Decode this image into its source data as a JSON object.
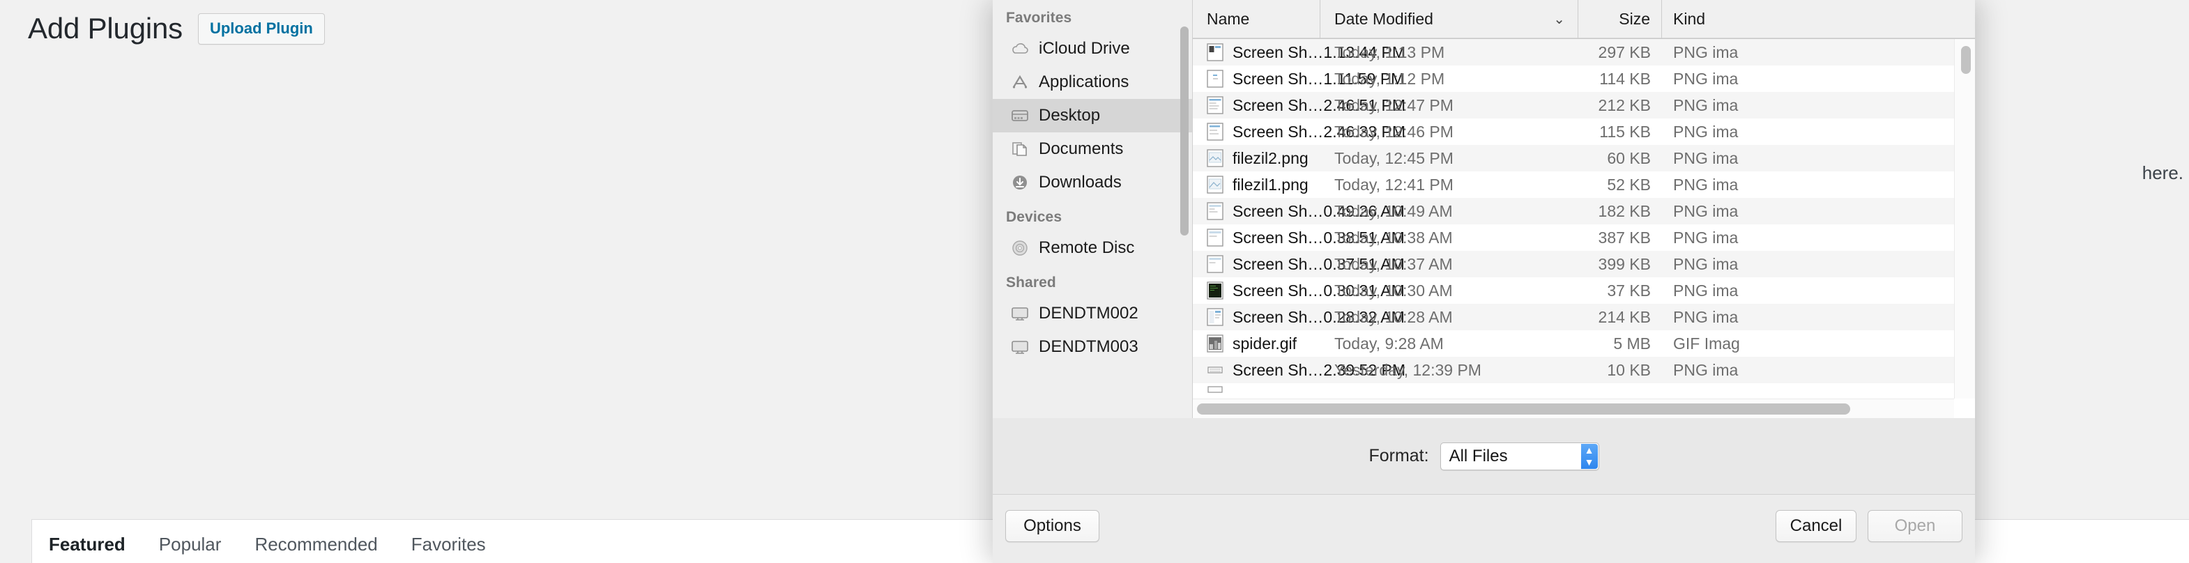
{
  "wp": {
    "title": "Add Plugins",
    "upload_button": "Upload Plugin",
    "upload_hint_visible": "here.",
    "tabs": [
      {
        "label": "Featured",
        "active": true
      },
      {
        "label": "Popular",
        "active": false
      },
      {
        "label": "Recommended",
        "active": false
      },
      {
        "label": "Favorites",
        "active": false
      }
    ]
  },
  "dialog": {
    "sidebar": {
      "groups": [
        {
          "title": "Favorites",
          "items": [
            {
              "label": "iCloud Drive",
              "icon": "icloud-drive-icon",
              "selected": false
            },
            {
              "label": "Applications",
              "icon": "applications-icon",
              "selected": false
            },
            {
              "label": "Desktop",
              "icon": "desktop-folder-icon",
              "selected": true
            },
            {
              "label": "Documents",
              "icon": "documents-folder-icon",
              "selected": false
            },
            {
              "label": "Downloads",
              "icon": "downloads-folder-icon",
              "selected": false
            }
          ]
        },
        {
          "title": "Devices",
          "items": [
            {
              "label": "Remote Disc",
              "icon": "remote-disc-icon",
              "selected": false
            }
          ]
        },
        {
          "title": "Shared",
          "items": [
            {
              "label": "DENDTM002",
              "icon": "shared-computer-icon",
              "selected": false
            },
            {
              "label": "DENDTM003",
              "icon": "shared-computer-icon",
              "selected": false
            }
          ]
        }
      ]
    },
    "file_list": {
      "columns": [
        "Name",
        "Date Modified",
        "Size",
        "Kind"
      ],
      "sorted_by": "Date Modified",
      "sort_indicator": "⌄",
      "rows": [
        {
          "name": "Screen Sh…1.13.44 PM",
          "date": "Today, 1:13 PM",
          "size": "297 KB",
          "kind": "PNG ima",
          "icon": "png-file-icon"
        },
        {
          "name": "Screen Sh…1.11.59 PM",
          "date": "Today, 1:12 PM",
          "size": "114 KB",
          "kind": "PNG ima",
          "icon": "png-file-icon"
        },
        {
          "name": "Screen Sh…2.46.51 PM",
          "date": "Today, 12:47 PM",
          "size": "212 KB",
          "kind": "PNG ima",
          "icon": "png-file-icon"
        },
        {
          "name": "Screen Sh…2.46.33 PM",
          "date": "Today, 12:46 PM",
          "size": "115 KB",
          "kind": "PNG ima",
          "icon": "png-file-icon"
        },
        {
          "name": "filezil2.png",
          "date": "Today, 12:45 PM",
          "size": "60 KB",
          "kind": "PNG ima",
          "icon": "png-file-icon"
        },
        {
          "name": "filezil1.png",
          "date": "Today, 12:41 PM",
          "size": "52 KB",
          "kind": "PNG ima",
          "icon": "png-file-icon"
        },
        {
          "name": "Screen Sh…0.49.26 AM",
          "date": "Today, 10:49 AM",
          "size": "182 KB",
          "kind": "PNG ima",
          "icon": "png-file-icon"
        },
        {
          "name": "Screen Sh…0.38.51 AM",
          "date": "Today, 10:38 AM",
          "size": "387 KB",
          "kind": "PNG ima",
          "icon": "png-file-icon"
        },
        {
          "name": "Screen Sh…0.37.51 AM",
          "date": "Today, 10:37 AM",
          "size": "399 KB",
          "kind": "PNG ima",
          "icon": "png-file-icon"
        },
        {
          "name": "Screen Sh…0.30.31 AM",
          "date": "Today, 10:30 AM",
          "size": "37 KB",
          "kind": "PNG ima",
          "icon": "png-file-dark-icon"
        },
        {
          "name": "Screen Sh…0.28.32 AM",
          "date": "Today, 10:28 AM",
          "size": "214 KB",
          "kind": "PNG ima",
          "icon": "png-file-icon"
        },
        {
          "name": "spider.gif",
          "date": "Today, 9:28 AM",
          "size": "5 MB",
          "kind": "GIF Imag",
          "icon": "gif-file-icon"
        },
        {
          "name": "Screen Sh…2.39.52 PM",
          "date": "Yesterday, 12:39 PM",
          "size": "10 KB",
          "kind": "PNG ima",
          "icon": "png-file-icon"
        }
      ]
    },
    "format": {
      "label": "Format:",
      "value": "All Files"
    },
    "buttons": {
      "options": "Options",
      "cancel": "Cancel",
      "open": "Open"
    }
  },
  "colors": {
    "wp_link": "#0071a1",
    "stepper_blue": "#2e86ee",
    "selection_grey": "#d6d6d6"
  }
}
